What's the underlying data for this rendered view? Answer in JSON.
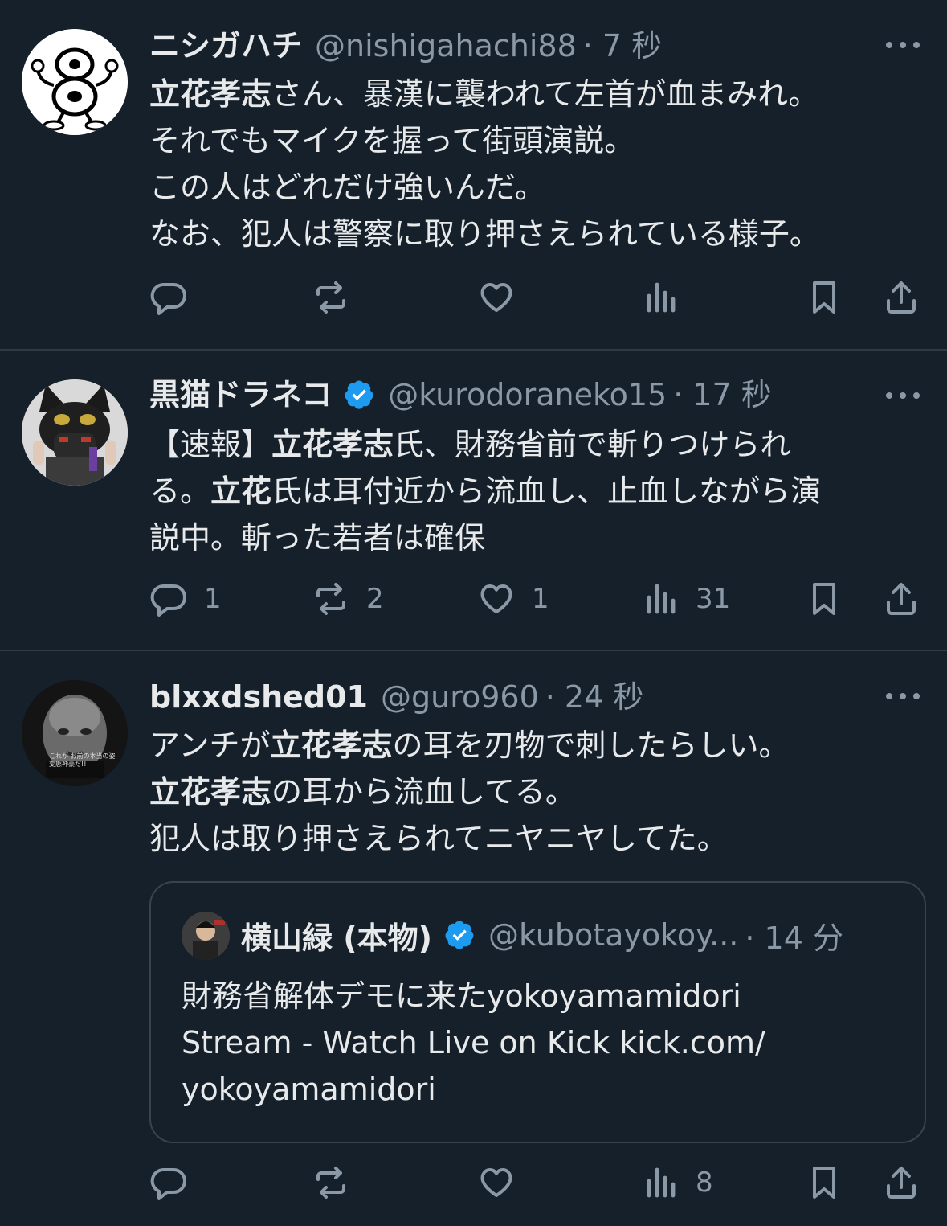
{
  "tweets": [
    {
      "name": "ニシガハチ",
      "handle": "@nishigahachi88",
      "time": "· 7 秒",
      "verified": false,
      "lines": [
        [
          {
            "t": "立花孝志",
            "b": true
          },
          {
            "t": "さん、暴漢に襲われて左首が血まみれ。"
          }
        ],
        [
          {
            "t": "それでもマイクを握って街頭演説。"
          }
        ],
        [
          {
            "t": "この人はどれだけ強いんだ。"
          }
        ],
        [
          {
            "t": "なお、犯人は警察に取り押さえられている様子。"
          }
        ]
      ],
      "actions": {
        "reply": "",
        "retweet": "",
        "like": "",
        "views": ""
      }
    },
    {
      "name": "黒猫ドラネコ",
      "handle": "@kurodoraneko15",
      "time": "· 17 秒",
      "verified": true,
      "lines": [
        [
          {
            "t": "【速報】"
          },
          {
            "t": "立花孝志",
            "b": true
          },
          {
            "t": "氏、財務省前で斬りつけられ"
          }
        ],
        [
          {
            "t": "る。"
          },
          {
            "t": "立花",
            "b": true
          },
          {
            "t": "氏は耳付近から流血し、止血しながら演"
          }
        ],
        [
          {
            "t": "説中。斬った若者は確保"
          }
        ]
      ],
      "actions": {
        "reply": "1",
        "retweet": "2",
        "like": "1",
        "views": "31"
      }
    },
    {
      "name": "blxxdshed01",
      "handle": "@guro960",
      "time": "· 24 秒",
      "verified": false,
      "lines": [
        [
          {
            "t": "アンチが"
          },
          {
            "t": "立花孝志",
            "b": true
          },
          {
            "t": "の耳を刃物で刺したらしい。"
          }
        ],
        [
          {
            "t": "立花孝志",
            "b": true
          },
          {
            "t": "の耳から流血してる。"
          }
        ],
        [
          {
            "t": "犯人は取り押さえられてニヤニヤしてた。"
          }
        ]
      ],
      "actions": {
        "reply": "",
        "retweet": "",
        "like": "",
        "views": "8"
      }
    }
  ],
  "quote": {
    "name": "横山緑 (本物)",
    "handle": "@kubotayokoy...",
    "time": "· 14 分",
    "lines": [
      "財務省解体デモに来たyokoyamamidori",
      "Stream - Watch Live on Kick kick.com/",
      "yokoyamamidori"
    ]
  },
  "avatars": {
    "t0": "8 cartoon character",
    "t1_caption": "",
    "t2_caption": "これが お前の本当の姿 変態神豪だ!!"
  },
  "colors": {
    "background": "#15202b",
    "text": "#e7e9ea",
    "muted": "#8b98a5",
    "verified": "#1d9bf0",
    "border": "#38444d"
  }
}
